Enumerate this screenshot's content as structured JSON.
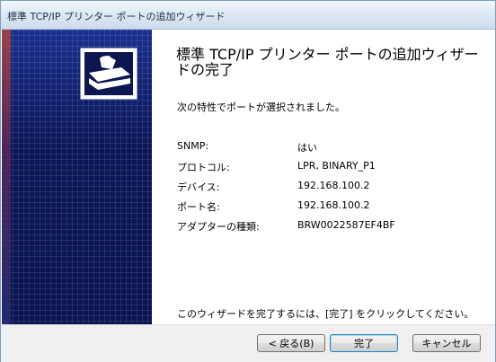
{
  "window": {
    "title": "標準 TCP/IP プリンター ポートの追加ウィザード"
  },
  "heading": "標準 TCP/IP プリンター ポートの追加ウィザードの完了",
  "intro": "次の特性でポートが選択されました。",
  "properties": [
    {
      "label": "SNMP:",
      "value": "はい"
    },
    {
      "label": "プロトコル:",
      "value": "LPR, BINARY_P1"
    },
    {
      "label": "デバイス:",
      "value": "192.168.100.2"
    },
    {
      "label": "ポート名:",
      "value": "192.168.100.2"
    },
    {
      "label": "アダプターの種類:",
      "value": "BRW0022587EF4BF"
    }
  ],
  "finish_note": "このウィザードを完了するには、[完了] をクリックしてください。",
  "buttons": {
    "back": "< 戻る(B)",
    "finish": "完了",
    "cancel": "キャンセル"
  },
  "icons": {
    "wizard": "printer-wizard-icon"
  }
}
